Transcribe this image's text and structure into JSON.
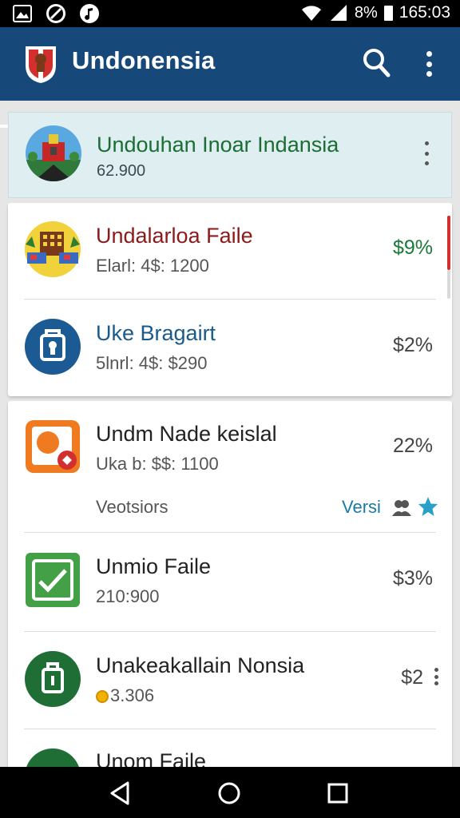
{
  "status_bar": {
    "battery": "8%",
    "time": "165:03",
    "icons": [
      "image-icon",
      "no-sync-icon",
      "music-icon",
      "wifi-icon",
      "signal-icon",
      "battery-icon"
    ]
  },
  "app_bar": {
    "title": "Undonensia",
    "icons": [
      "app-logo-icon",
      "search-icon",
      "more-vert-icon"
    ],
    "colors": {
      "bar": "#17487a",
      "text": "#ffffff"
    }
  },
  "featured": {
    "title": "Undouhan Inoar Indansia",
    "subtitle": "62.900",
    "colors": {
      "background": "#dfeef0",
      "title": "#1a6e35"
    }
  },
  "items": [
    {
      "title": "Undalarloa Faile",
      "subtitle": "Elarl: 4$: 1200",
      "value": "$9%",
      "title_color": "#8b1a1a",
      "value_color": "#1a7a3a",
      "icon": "city-market-icon"
    },
    {
      "title": "Uke Bragairt",
      "subtitle": "5lnrl: 4$: $290",
      "value": "$2%",
      "title_color": "#1a5a8a",
      "value_color": "#444444",
      "icon": "bag-icon"
    },
    {
      "title": "Undm Nade keislal",
      "subtitle": "Uka b: $$: 1100",
      "value": "22%",
      "title_color": "#222222",
      "value_color": "#444444",
      "icon": "photo-app-icon"
    },
    {
      "title": "Unmio Faile",
      "subtitle": "210:900",
      "value": "$3%",
      "title_color": "#222222",
      "value_color": "#444444",
      "icon": "check-file-icon"
    },
    {
      "title": "Unakeakallain Nonsia",
      "subtitle": "3.306",
      "value": "$2",
      "title_color": "#222222",
      "value_color": "#444444",
      "icon": "bag-green-icon"
    },
    {
      "title": "Unom Faile",
      "icon": "green-circle-icon"
    }
  ],
  "versions": {
    "label": "Veotsiors",
    "link": "Versi",
    "icons": [
      "people-icon",
      "star-icon"
    ]
  },
  "nav_bar": {
    "icons": [
      "back-icon",
      "home-icon",
      "recents-icon"
    ]
  }
}
